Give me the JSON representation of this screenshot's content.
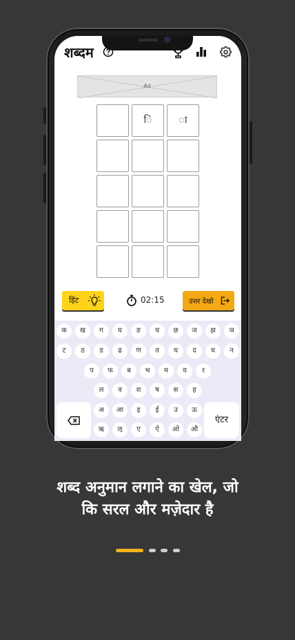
{
  "header": {
    "logo": "शब्दम"
  },
  "ad": {
    "label": "Ad"
  },
  "grid": {
    "rows": [
      [
        "",
        "ि",
        "ा"
      ],
      [
        "",
        "",
        ""
      ],
      [
        "",
        "",
        ""
      ],
      [
        "",
        "",
        ""
      ],
      [
        "",
        "",
        ""
      ]
    ]
  },
  "controls": {
    "hint_label": "हिंट",
    "timer": "02:15",
    "answer_label": "उत्तर देखो"
  },
  "keyboard": {
    "rows": [
      [
        "क",
        "ख",
        "ग",
        "घ",
        "ङ",
        "च",
        "छ",
        "ज",
        "झ",
        "ञ"
      ],
      [
        "ट",
        "ठ",
        "ड",
        "ढ",
        "ण",
        "त",
        "थ",
        "द",
        "ध",
        "न"
      ],
      [
        "प",
        "फ",
        "ब",
        "भ",
        "म",
        "य",
        "र"
      ],
      [
        "ल",
        "व",
        "श",
        "ष",
        "स",
        "ह"
      ],
      [
        "अ",
        "आ",
        "इ",
        "ई",
        "उ",
        "ऊ"
      ],
      [
        "ऋ",
        "ऌ",
        "ए",
        "ऐ",
        "ओ",
        "औ"
      ]
    ],
    "enter_label": "एंटर"
  },
  "tagline": {
    "line1": "शब्द अनुमान लगाने का खेल, जो",
    "line2": "कि सरल और मज़ेदार है"
  },
  "pagination": {
    "total": 4,
    "active": 0
  },
  "colors": {
    "accent": "#f7b21b",
    "hint": "#ffd21a",
    "answer": "#f3a814",
    "background": "#373737"
  }
}
